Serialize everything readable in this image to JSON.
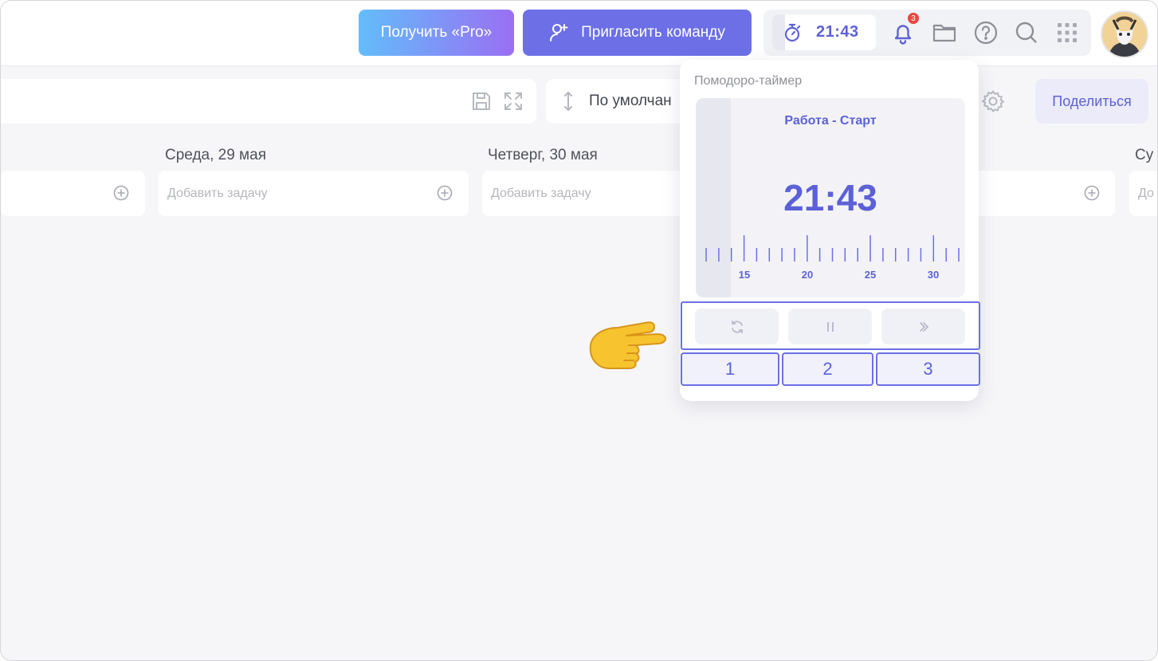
{
  "header": {
    "pro_button": "Получить «Pro»",
    "invite_button": "Пригласить команду",
    "timer_value": "21:43",
    "notifications_count": "3"
  },
  "toolbar": {
    "sort_label": "По умолчан",
    "share_button": "Поделиться"
  },
  "days": [
    {
      "title": "Среда, 29 мая",
      "placeholder": "Добавить задачу"
    },
    {
      "title": "Четверг, 30 мая",
      "placeholder": "Добавить задачу"
    },
    {
      "title": "Су",
      "placeholder": "До"
    }
  ],
  "pomodoro": {
    "title": "Помодоро-таймер",
    "phase": "Работа - Старт",
    "time": "21:43",
    "ruler_labels": [
      "15",
      "20",
      "25",
      "30"
    ],
    "controls": [
      "refresh-icon",
      "pause-icon",
      "skip-icon"
    ],
    "annotations": [
      "1",
      "2",
      "3"
    ]
  },
  "colors": {
    "accent": "#5c61d8",
    "invite_bg": "#6c6fe6",
    "badge": "#e5483f",
    "pro_gradient_start": "#62bdfb",
    "pro_gradient_end": "#9a6ff3"
  }
}
